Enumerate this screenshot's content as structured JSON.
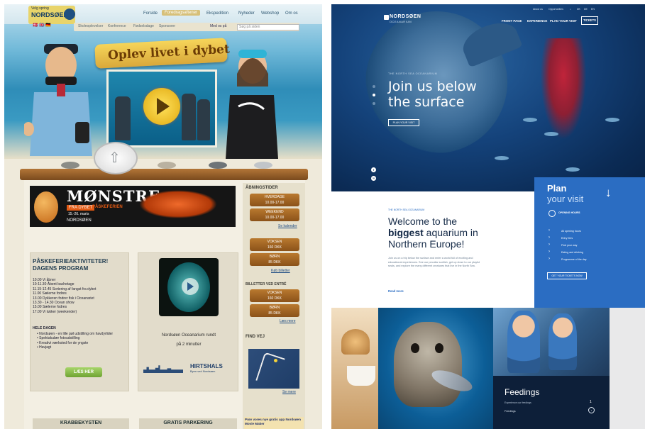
{
  "left_site": {
    "logo": {
      "tagline": "Velg spring",
      "name": "NORDSØEN"
    },
    "nav": [
      "Forside",
      "Foredragsaftener",
      "Ekspedition",
      "Nyheder",
      "Webshop",
      "Om os"
    ],
    "nav_active_index": 1,
    "subnav": [
      "Skoleoplevelser",
      "Konference",
      "Fødselsdage",
      "Sponsorer"
    ],
    "flags": "🇩🇰 🇬🇧 🇩🇪",
    "share": "Med os på",
    "search_placeholder": "Søg på siden",
    "banner": "Oplev livet i dybet",
    "ad": {
      "title": "MØNSTRE",
      "fra": "FRA DYBET",
      "paaske": "PÅSKEFERIEN",
      "dates": "15.-26. marts",
      "logo": "NORDSØEN"
    },
    "opening": {
      "heading": "ÅBNINGSTIDER",
      "pills": [
        [
          "HVERDAGE",
          "10.00-17.00"
        ],
        [
          "WEEKEND",
          "10.00-17.00"
        ]
      ],
      "link": "Se kalender"
    },
    "prices_top": {
      "pills": [
        [
          "VOKSEN",
          "160 DKK"
        ],
        [
          "BØRN",
          "85 DKK"
        ]
      ],
      "link": "Køb billetter"
    },
    "tickets": {
      "heading": "BILLETTER VED ENTRÉ",
      "pills": [
        [
          "VOKSEN",
          "160 DKK"
        ],
        [
          "BØRN",
          "85 DKK"
        ]
      ],
      "link": "Læs mere"
    },
    "route": {
      "heading": "FIND VEJ",
      "link": "Se mere"
    },
    "program": {
      "title_line1": "PÅSKEFERIEAKTIVITETER!",
      "title_line2": "DAGENS PROGRAM",
      "items": [
        "10.00 Vi åbner",
        "10-11.30 Åbent bachetage",
        "11.15-12.45 Sortering af fangst fra dybet",
        "11.00 Sælerne fodres",
        "13.00 Dykkeren fodrer fisk i Oceanariet",
        "13.30 - 14.30 Ocean show",
        "15.00 Sælerne fodres",
        "17.00 Vi lukker (weekender)"
      ],
      "hele_dagen": "HELE DAGEN",
      "bullets": [
        "Nordsøen - en lille pøl udstilling om havdyrlider",
        "Spektakulær fotoudstilling",
        "Kreativt værksted for de yngste",
        "Havjagt"
      ],
      "button": "LÆS HER"
    },
    "video_caption_1": "Nordsøen Oceanarium rundt",
    "video_caption_2": "på 2 minutter",
    "hirtshals": {
      "name": "HIRTSHALS",
      "sub": "Byen ved Nordsøen"
    },
    "bottom": [
      "KRABBEKYSTEN",
      "GRATIS PARKERING"
    ],
    "app_promo": "Prøv vores nye gratis app Nordsøen Movie Maker"
  },
  "right_site": {
    "logo": {
      "name": "NORDSØEN",
      "sub": "OCEANARIUM"
    },
    "top_links": [
      "About us",
      "Opportunities",
      "DK",
      "DE",
      "EN"
    ],
    "nav": [
      "FRONT PAGE",
      "EXPERIENCE",
      "PLAN YOUR VISIT"
    ],
    "tickets_button": "TICKETS",
    "hero": {
      "kicker": "THE NORTH SEA OCEANARIUM",
      "line1": "Join us below",
      "line2": "the surface",
      "button": "PLAN YOUR VISIT"
    },
    "social": [
      "f",
      "ig"
    ],
    "plan": {
      "title1": "Plan",
      "title2": "your visit",
      "opening_hours": "OPENING HOURS",
      "links": [
        "All opening hours",
        "Entry fees",
        "Find your way",
        "Eating and drinking",
        "Programme of the day"
      ],
      "button": "GET YOUR TICKETS NOW"
    },
    "welcome": {
      "kicker": "THE NORTH SEA OCEANARIUM",
      "line1": "Welcome to the",
      "line2_bold": "biggest",
      "line2_rest": " aquarium in",
      "line3": "Northern Europe!",
      "paragraph": "Join us on a trip below the surface and enter a world full of exciting and educational experiences. See our peculiar sunfish, get up close to our playful seals, and explore the many different creatures that live in the North Sea.",
      "more": "Read more"
    },
    "feedings": {
      "title": "Feedings",
      "subtitle": "Experience our feedings",
      "link": "Feedings",
      "count": "1"
    }
  }
}
